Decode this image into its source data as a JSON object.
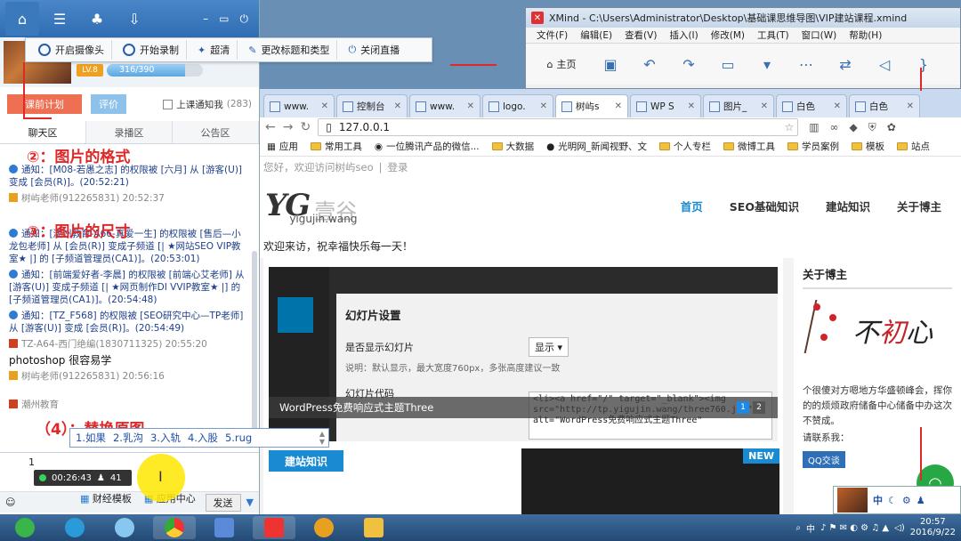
{
  "xmind": {
    "title": "XMind - C:\\Users\\Administrator\\Desktop\\基础课思维导图\\VIP建站课程.xmind",
    "menus": [
      "文件(F)",
      "编辑(E)",
      "查看(V)",
      "插入(I)",
      "修改(M)",
      "工具(T)",
      "窗口(W)",
      "帮助(H)"
    ],
    "home_label": "主页"
  },
  "browser": {
    "tabs": [
      {
        "label": "www."
      },
      {
        "label": "控制台"
      },
      {
        "label": "www."
      },
      {
        "label": "logo."
      },
      {
        "label": "树屿s"
      },
      {
        "label": "WP S"
      },
      {
        "label": "图片_"
      },
      {
        "label": "白色"
      },
      {
        "label": "白色"
      }
    ],
    "url": "127.0.0.1",
    "bookmarks": [
      "应用",
      "常用工具",
      "一位腾讯产品的微信...",
      "大数据",
      "光明网_新闻视野、文",
      "个人专栏",
      "微博工具",
      "学员案例",
      "模板",
      "站点"
    ],
    "page": {
      "topnote": "您好，欢迎访问树屿seo",
      "login": "登录",
      "logo_mark": "YG",
      "logo_cn": "壹谷",
      "logo_domain": "yigujin.wang",
      "nav": [
        "首页",
        "SEO基础知识",
        "建站知识",
        "关于博主"
      ],
      "welcome": "欢迎来访，祝幸福快乐每一天！",
      "wp_title": "幻灯片设置",
      "wp_show_label": "是否显示幻灯片",
      "wp_show_value": "显示 ▾",
      "wp_hint": "说明：默认显示，最大宽度760px，多张高度建议一致",
      "wp_code_label": "幻灯片代码",
      "wp_code": "<li><a href=\"/\" target=\"_blank\"><img src=\"http://tp.yigujin.wang/three760.jpg\" alt=\"WordPress免费响应式主题Three\"",
      "caption": "WordPress免费响应式主题Three",
      "slide_dots": [
        "1",
        "2"
      ],
      "section_title": "建站知识",
      "new_badge": "NEW",
      "sidebar_title": "关于博主",
      "sidebar_text": "个很傻对方嗯地方华盛顿峰会，挥你的的烦烦政府储备中心储备中办这次不赞成。",
      "contact": "请联系我：",
      "qq": "QQ交谈"
    }
  },
  "live": {
    "progress": {
      "level": "LV.8",
      "current": 316,
      "total": 390,
      "text": "316/390"
    },
    "float_toolbar": [
      "开启摄像头",
      "开始录制",
      "超清",
      "更改标题和类型",
      "关闭直播"
    ],
    "buttons": {
      "plan": "课前计划",
      "rate": "评价"
    },
    "notify_label": "上课通知我",
    "notify_count": "(283)",
    "tabs": [
      "聊天区",
      "录播区",
      "公告区"
    ],
    "messages": [
      {
        "type": "notice",
        "text": "通知：[M08-若愚之志] 的权限被 [六月] 从 [游客(U)] 变成 [会员(R)]。(20:52:21)"
      },
      {
        "type": "who",
        "text": "树屿老师(912265831) 20:52:37"
      },
      {
        "type": "notice",
        "text": "通知：[潮州教育-A66-真爱一生] 的权限被 [售后—小龙包老师] 从 [会员(R)] 变成子频道 [| ★网站SEO  VIP教室★ |] 的 [子频道管理员(CA1)]。(20:53:01)"
      },
      {
        "type": "notice",
        "text": "通知：[前端爱好者-李晨] 的权限被 [前端心艾老师] 从 [游客(U)] 变成子频道 [| ★网页制作DI VVIP教室★ |] 的 [子频道管理员(CA1)]。(20:54:48)"
      },
      {
        "type": "notice",
        "text": "通知：[TZ_F568] 的权限被 [SEO研究中心—TP老师] 从 [游客(U)] 变成 [会员(R)]。(20:54:49)"
      },
      {
        "type": "who",
        "text": "TZ-A64-西门绝编(1830711325) 20:55:20"
      },
      {
        "type": "big",
        "text": "photoshop 很容易学"
      },
      {
        "type": "who",
        "text": "树屿老师(912265831) 20:56:16"
      },
      {
        "type": "who",
        "text": "潮州教育"
      }
    ],
    "annotations": [
      "②：图片的格式",
      "③：图片的尺寸",
      "（4）：替换原图"
    ],
    "ime_candidates": [
      "1.如果",
      "2.乳沟",
      "3.入轨",
      "4.入股",
      "5.rug"
    ],
    "typed_text": "1",
    "timer": "00:26:43",
    "viewers": "41",
    "send_label": "发送",
    "apps": [
      "财经模板",
      "应用中心"
    ]
  },
  "taskbar": {
    "ime_indicator": "中",
    "time": "20:57",
    "date": "2016/9/22"
  },
  "colors": {
    "accent": "#1a8bd2",
    "annotation": "#e02828",
    "taskbar": "#234a74"
  }
}
